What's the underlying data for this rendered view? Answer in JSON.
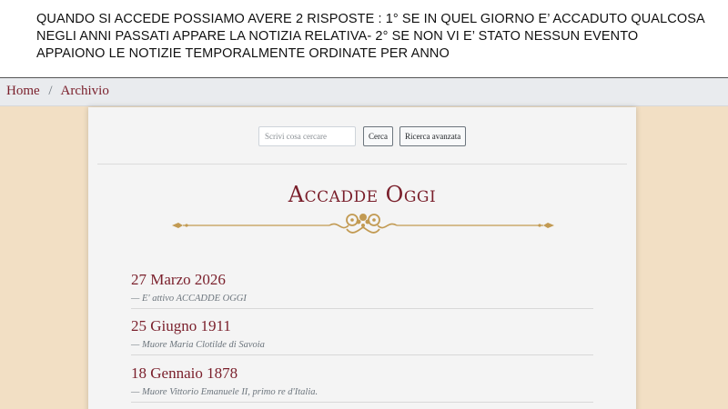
{
  "caption": "QUANDO SI ACCEDE POSSIAMO AVERE 2 RISPOSTE : 1° SE IN QUEL GIORNO E’ ACCADUTO QUALCOSA NEGLI ANNI PASSATI APPARE LA NOTIZIA RELATIVA- 2° SE NON VI E’ STATO NESSUN EVENTO APPAIONO LE NOTIZIE TEMPORALMENTE ORDINATE PER ANNO",
  "breadcrumb": {
    "home": "Home",
    "separator": "/",
    "current": "Archivio"
  },
  "search": {
    "placeholder": "Scrivi cosa cercare",
    "value": "",
    "search_button": "Cerca",
    "advanced_button": "Ricerca avanzata"
  },
  "page_title": "Accadde Oggi",
  "events": [
    {
      "date": "27 Marzo 2026",
      "description": "—  E' attivo ACCADDE OGGI"
    },
    {
      "date": "25 Giugno 1911",
      "description": "—  Muore Maria Clotilde di Savoia"
    },
    {
      "date": "18 Gennaio 1878",
      "description": "—  Muore Vittorio Emanuele II, primo re d'Italia."
    }
  ],
  "colors": {
    "accent": "#7a1f2b",
    "ornament": "#c29a52",
    "page_background": "#f2dfc4",
    "card_background": "#f4f4f4"
  }
}
